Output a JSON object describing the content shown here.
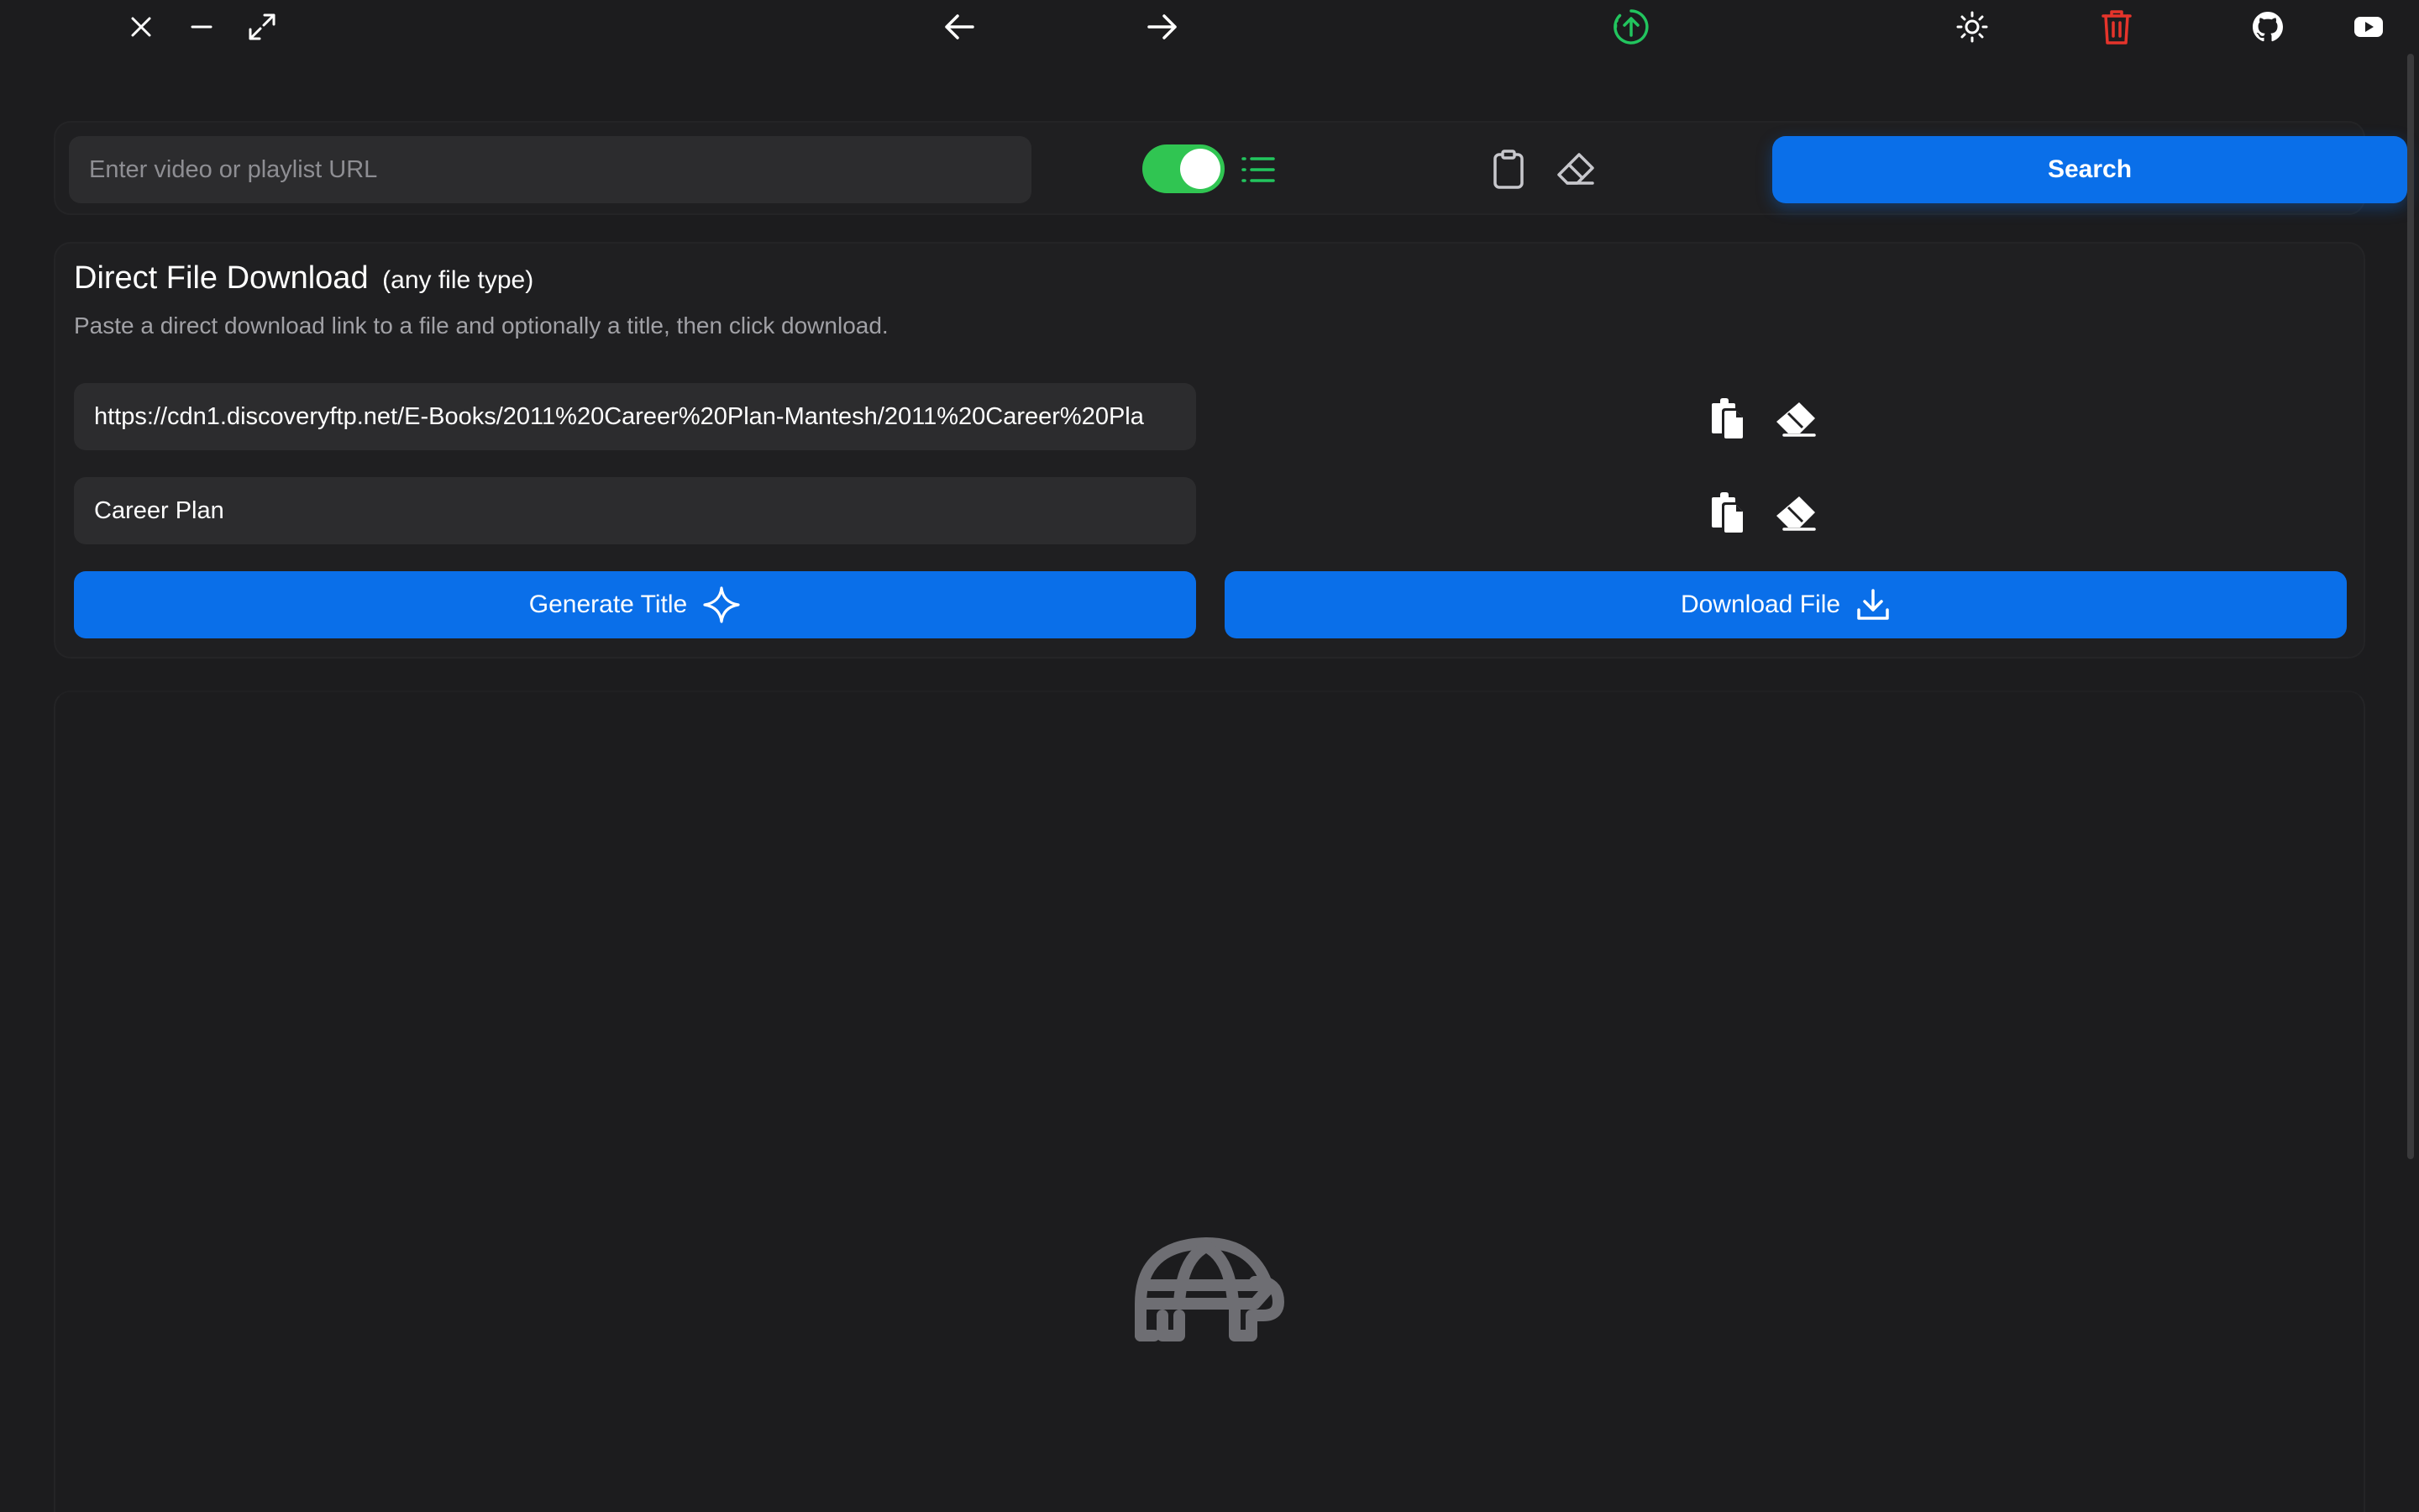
{
  "titlebar": {
    "icons": [
      "close-icon",
      "minimize-icon",
      "maximize-icon",
      "arrow-left-icon",
      "arrow-right-icon",
      "update-icon",
      "sun-icon",
      "trash-icon",
      "github-icon",
      "youtube-icon"
    ],
    "colors": {
      "update": "#22c55e",
      "trash": "#e5342b",
      "default": "#ffffff"
    }
  },
  "search": {
    "placeholder": "Enter video or playlist URL",
    "value": "",
    "playlist_toggle_on": true,
    "button_label": "Search"
  },
  "direct_download": {
    "title": "Direct File Download",
    "title_note": "(any file type)",
    "description": "Paste a direct download link to a file and optionally a title, then click download.",
    "url_value": "https://cdn1.discoveryftp.net/E-Books/2011%20Career%20Plan-Mantesh/2011%20Career%20Pla",
    "title_value": "Career Plan",
    "generate_label": "Generate Title",
    "download_label": "Download File"
  },
  "colors": {
    "background": "#1c1c1e",
    "card": "#1f1f21",
    "input": "#2c2c2e",
    "accent": "#0a6fe9",
    "toggle": "#30c552",
    "muted_text": "#a1a1a6",
    "placeholder_icon": "#6e6e73"
  }
}
